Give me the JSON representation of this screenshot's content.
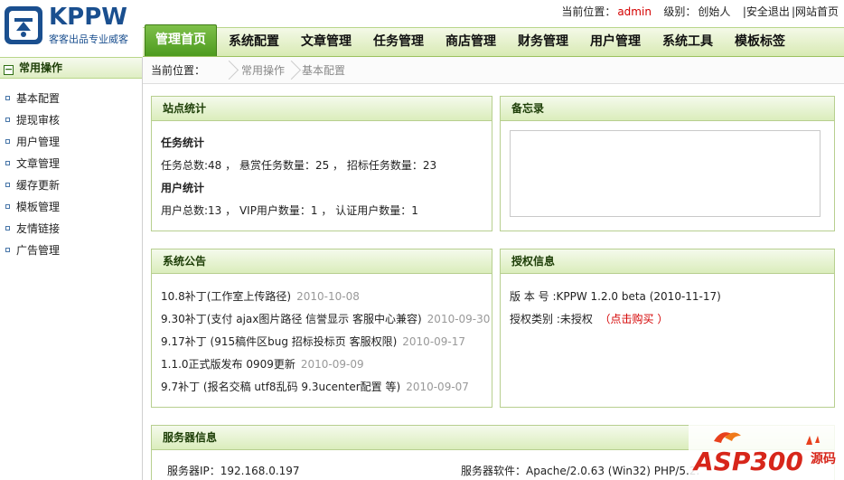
{
  "header": {
    "logo_title": "KPPW",
    "logo_subtitle": "客客出品专业威客",
    "location_label": "当前位置：",
    "user": "admin",
    "level_label": "级别：",
    "level_value": "创始人",
    "logout": "安全退出",
    "site_home": "网站首页",
    "separator": "|"
  },
  "nav": {
    "items": [
      {
        "label": "管理首页",
        "active": true
      },
      {
        "label": "系统配置"
      },
      {
        "label": "文章管理"
      },
      {
        "label": "任务管理"
      },
      {
        "label": "商店管理"
      },
      {
        "label": "财务管理"
      },
      {
        "label": "用户管理"
      },
      {
        "label": "系统工具"
      },
      {
        "label": "模板标签"
      }
    ]
  },
  "sidebar": {
    "toggle_glyph": "−",
    "title": "常用操作",
    "items": [
      "基本配置",
      "提现审核",
      "用户管理",
      "文章管理",
      "缓存更新",
      "模板管理",
      "友情链接",
      "广告管理"
    ]
  },
  "breadcrumb": {
    "label": "当前位置：",
    "items": [
      "常用操作",
      "基本配置"
    ]
  },
  "stats": {
    "title": "站点统计",
    "task_heading": "任务统计",
    "task_line": "任务总数:48 ， 悬赏任务数量：25 ， 招标任务数量：23",
    "user_heading": "用户统计",
    "user_line": "用户总数:13 ， VIP用户数量：1 ， 认证用户数量：1"
  },
  "memo": {
    "title": "备忘录"
  },
  "notices": {
    "title": "系统公告",
    "items": [
      {
        "text": "10.8补丁(工作室上传路径)",
        "date": "2010-10-08"
      },
      {
        "text": "9.30补丁(支付 ajax图片路径 信誉显示 客服中心兼容)",
        "date": "2010-09-30"
      },
      {
        "text": "9.17补丁 (915稿件区bug 招标投标页 客服权限)",
        "date": "2010-09-17"
      },
      {
        "text": "1.1.0正式版发布 0909更新",
        "date": "2010-09-09"
      },
      {
        "text": "9.7补丁 (报名交稿 utf8乱码 9.3ucenter配置 等)",
        "date": "2010-09-07"
      }
    ]
  },
  "license": {
    "title": "授权信息",
    "version_line": "版 本 号 :KPPW 1.2.0 beta (2010-11-17)",
    "type_label": "授权类别 :未授权",
    "buy_link": "（点击购买 ）"
  },
  "server": {
    "title": "服务器信息",
    "ip_line": "服务器IP：192.168.0.197",
    "software_line": "服务器软件：Apache/2.0.63 (Win32) PHP/5.2."
  },
  "watermark": {
    "text": "ASP300",
    "suffix": "源码"
  },
  "colors": {
    "accent_green": "#4d9a1e",
    "logo_blue": "#1a4f8f",
    "alert_red": "#d40000"
  }
}
